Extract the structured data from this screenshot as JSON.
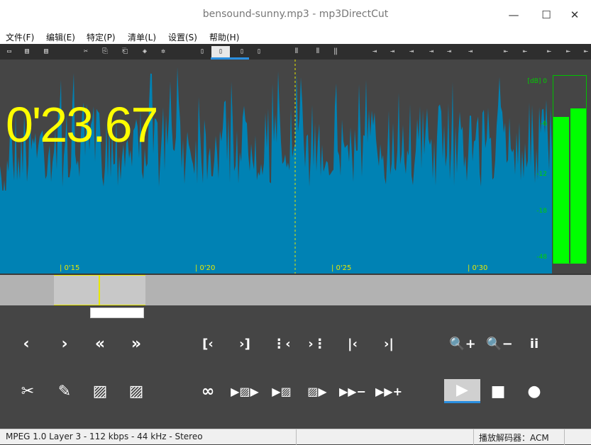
{
  "window": {
    "title": "bensound-sunny.mp3 - mp3DirectCut",
    "minimize_glyph": "—",
    "maximize_glyph": "☐",
    "close_glyph": "✕"
  },
  "menu": [
    "文件(F)",
    "编辑(E)",
    "特定(P)",
    "清单(L)",
    "设置(S)",
    "帮助(H)"
  ],
  "toolbar": {
    "icons": [
      "open-icon",
      "save-icon",
      "save-as-icon",
      "cut-icon",
      "copy-icon",
      "paste-icon",
      "normalize-icon",
      "settings-icon",
      "page-icon",
      "page-active-icon",
      "page-alt-icon",
      "page-list-icon",
      "markers-a-icon",
      "markers-b-icon",
      "markers-c-icon",
      "jump-a-icon",
      "jump-b-icon",
      "jump-c-icon",
      "jump-d-icon",
      "jump-e-icon",
      "jump-f-icon",
      "sel-a-icon",
      "sel-b-icon",
      "sel-c-icon",
      "sel-d-icon",
      "sel-e-icon"
    ],
    "glyphs": [
      "▭",
      "▤",
      "▤",
      "✂",
      "⎘",
      "⎗",
      "◈",
      "✲",
      "▯",
      "▯",
      "▯",
      "▯",
      "⦀",
      "⦀",
      "‖",
      "⇥",
      "⇥",
      "⇥",
      "⇥",
      "⇥",
      "⇥",
      "⇤",
      "⇤",
      "⇤",
      "⇤",
      "⇤"
    ]
  },
  "display": {
    "time": "0'23.67",
    "ticks": [
      "| 0'15",
      "| 0'20",
      "| 0'25",
      "| 0'30"
    ]
  },
  "meter": {
    "db_label": "[dB]  0",
    "scale": [
      "-6",
      "-12",
      "-18",
      "-48"
    ],
    "levels": [
      0.82,
      0.87
    ],
    "accent": "#00ff00"
  },
  "colors": {
    "waveform": "#0082b4",
    "timecode": "#ffff00",
    "background": "#454545"
  },
  "controls": {
    "row1": [
      {
        "name": "prev-frame-button",
        "glyph": "‹"
      },
      {
        "name": "next-frame-button",
        "glyph": "›"
      },
      {
        "name": "rewind-button",
        "glyph": "«"
      },
      {
        "name": "fast-forward-button",
        "glyph": "»"
      },
      {
        "name": "sel-start-back-button",
        "glyph": "[‹"
      },
      {
        "name": "sel-end-fwd-button",
        "glyph": "›]"
      },
      {
        "name": "cue-prev-button",
        "glyph": "⋮‹"
      },
      {
        "name": "cue-next-button",
        "glyph": "›⋮"
      },
      {
        "name": "goto-start-button",
        "glyph": "|‹"
      },
      {
        "name": "goto-end-button",
        "glyph": "›|"
      },
      {
        "name": "zoom-in-button",
        "glyph": "🔍+"
      },
      {
        "name": "zoom-out-button",
        "glyph": "🔍−"
      },
      {
        "name": "info-button",
        "glyph": "ii"
      }
    ],
    "row2": [
      {
        "name": "cut-button",
        "glyph": "✂"
      },
      {
        "name": "edit-button",
        "glyph": "✎"
      },
      {
        "name": "mark-a-button",
        "glyph": "▨"
      },
      {
        "name": "mark-b-button",
        "glyph": "▨"
      },
      {
        "name": "loop-button",
        "glyph": "∞"
      },
      {
        "name": "play-sel-button",
        "glyph": "▶▨▶"
      },
      {
        "name": "play-to-end-button",
        "glyph": "▶▨"
      },
      {
        "name": "play-from-button",
        "glyph": "▨▶"
      },
      {
        "name": "play-minus-button",
        "glyph": "▶▶−"
      },
      {
        "name": "play-plus-button",
        "glyph": "▶▶+"
      },
      {
        "name": "stop-button",
        "glyph": "■"
      },
      {
        "name": "record-button",
        "glyph": "●"
      }
    ],
    "play_glyph": "▶"
  },
  "status": {
    "format": "MPEG 1.0 Layer 3  -  112 kbps  -  44 kHz  -  Stereo",
    "decoder": "播放解码器：ACM"
  }
}
